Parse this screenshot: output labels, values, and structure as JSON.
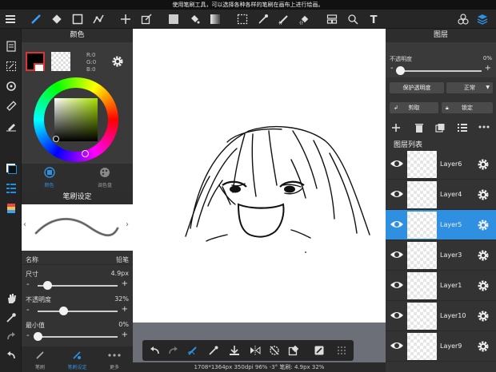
{
  "hint": "使用笔刷工具，可以选择各种各样的笔刷在画布上进行绘画。",
  "color_panel": {
    "title": "颜色",
    "r": "R:0",
    "g": "G:0",
    "b": "B:0",
    "tab_color": "颜色",
    "tab_palette": "调色盘"
  },
  "brush_panel": {
    "title": "笔刷设定",
    "name_label": "名称",
    "name_value": "铅笔",
    "size_label": "尺寸",
    "size_value": "4.9px",
    "size_level": 0.12,
    "opacity_label": "不透明度",
    "opacity_value": "32%",
    "opacity_level": 0.32,
    "min_label": "最小值",
    "min_value": "0%",
    "min_level": 0.0,
    "minus": "-",
    "plus": "+"
  },
  "bottom_tabs": {
    "brush": "笔刷",
    "brush_settings": "笔刷设定",
    "more": "更多"
  },
  "layers_panel": {
    "title": "图层",
    "opacity_label": "不透明度",
    "opacity_value": "0%",
    "opacity_level": 0.0,
    "protect_alpha": "保护透明度",
    "blend_mode": "正常",
    "clip": "剪取",
    "lock": "锁定",
    "list_title": "图层列表",
    "minus": "-",
    "plus": "+",
    "layers": [
      {
        "name": "Layer6",
        "selected": false
      },
      {
        "name": "Layer4",
        "selected": false
      },
      {
        "name": "Layer5",
        "selected": true
      },
      {
        "name": "Layer3",
        "selected": false
      },
      {
        "name": "Layer1",
        "selected": false
      },
      {
        "name": "Layer10",
        "selected": false
      },
      {
        "name": "Layer9",
        "selected": false
      }
    ]
  },
  "status_bar": "1708*1364px 350dpi 96% -3° 笔刷: 4.9px 32%",
  "colors": {
    "accent": "#1f8fe0",
    "selected_layer": "#2f8fe0",
    "panel": "#333333"
  }
}
